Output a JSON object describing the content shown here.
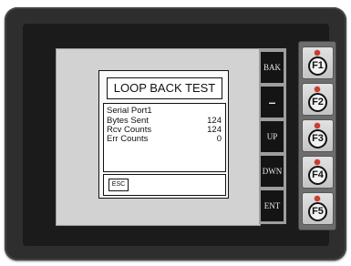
{
  "dialog": {
    "title": "LOOP BACK TEST",
    "port": "Serial Port1",
    "rows": [
      {
        "label": "Bytes Sent",
        "value": "124"
      },
      {
        "label": "Rcv  Counts",
        "value": "124"
      },
      {
        "label": "Err  Counts",
        "value": "0"
      }
    ],
    "esc_label": "ESC"
  },
  "softkeys": [
    "BAK",
    "–",
    "UP",
    "DWN",
    "ENT"
  ],
  "function_keys": [
    "F1",
    "F2",
    "F3",
    "F4",
    "F5"
  ],
  "colors": {
    "bezel": "#2e2e2e",
    "screen": "#d2d2d2",
    "led": "#d23a2a"
  }
}
